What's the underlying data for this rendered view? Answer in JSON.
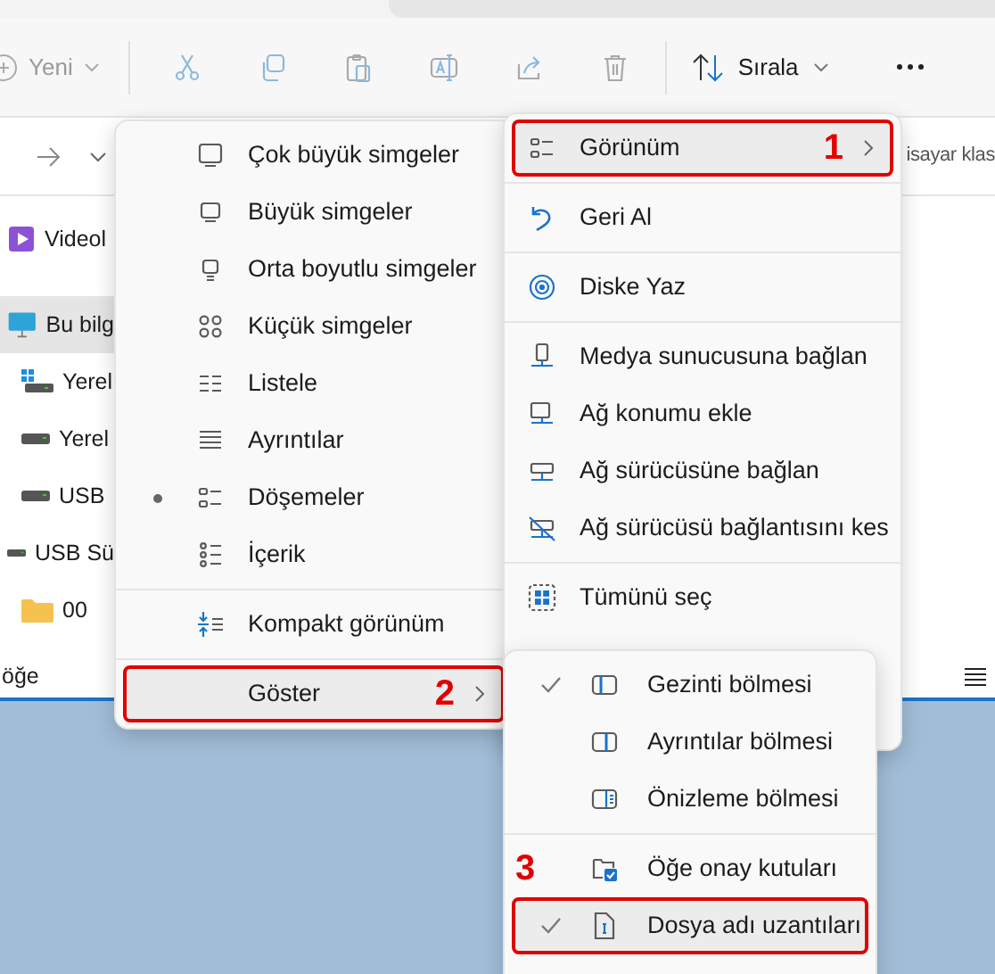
{
  "toolbar": {
    "new_label": "Yeni",
    "sort_label": "Sırala",
    "actions": [
      {
        "kind": "cut"
      },
      {
        "kind": "copy"
      },
      {
        "kind": "paste"
      },
      {
        "kind": "rename"
      },
      {
        "kind": "share"
      },
      {
        "kind": "delete"
      }
    ]
  },
  "address_bar": {
    "search_text": "isayar klas"
  },
  "sidebar": {
    "items": [
      {
        "label": "Videol",
        "kind": "videos",
        "selected": false
      },
      {
        "label": "Bu bilg",
        "kind": "computer",
        "selected": true,
        "children": [
          {
            "label": "Yerel",
            "kind": "system-drive",
            "selected": false
          },
          {
            "label": "Yerel",
            "kind": "drive",
            "selected": false
          },
          {
            "label": "USB",
            "kind": "drive",
            "selected": false
          }
        ]
      },
      {
        "label": "USB Sü",
        "kind": "drive",
        "selected": false,
        "children": [
          {
            "label": "00",
            "kind": "folder",
            "selected": false
          }
        ]
      }
    ]
  },
  "status_bar": {
    "text": "öğe"
  },
  "view_menu": {
    "groups": [
      [
        {
          "label": "Çok büyük simgeler",
          "kind": "xl",
          "selected": false
        },
        {
          "label": "Büyük simgeler",
          "kind": "large",
          "selected": false
        },
        {
          "label": "Orta boyutlu simgeler",
          "kind": "medium",
          "selected": false
        },
        {
          "label": "Küçük simgeler",
          "kind": "small",
          "selected": false
        },
        {
          "label": "Listele",
          "kind": "list",
          "selected": false
        },
        {
          "label": "Ayrıntılar",
          "kind": "details",
          "selected": false
        },
        {
          "label": "Döşemeler",
          "kind": "tiles",
          "selected": true
        },
        {
          "label": "İçerik",
          "kind": "content",
          "selected": false
        }
      ],
      [
        {
          "label": "Kompakt görünüm",
          "kind": "compact",
          "selected": false
        }
      ],
      [
        {
          "label": "Göster",
          "kind": "show",
          "highlighted": true,
          "annotation": "2"
        }
      ]
    ]
  },
  "context_menu": {
    "groups": [
      [
        {
          "label": "Görünüm",
          "kind": "tiles",
          "highlighted": true,
          "annotation": "1"
        }
      ],
      [
        {
          "label": "Geri Al",
          "kind": "undo"
        }
      ],
      [
        {
          "label": "Diske Yaz",
          "kind": "disc"
        }
      ],
      [
        {
          "label": "Medya sunucusuna bağlan",
          "kind": "media-server"
        },
        {
          "label": "Ağ konumu ekle",
          "kind": "net-location"
        },
        {
          "label": "Ağ sürücüsüne bağlan",
          "kind": "net-drive"
        },
        {
          "label": "Ağ sürücüsü bağlantısını kes",
          "kind": "net-disconnect"
        }
      ],
      [
        {
          "label": "Tümünü seç",
          "kind": "select-all"
        }
      ]
    ]
  },
  "show_menu": {
    "groups": [
      [
        {
          "label": "Gezinti bölmesi",
          "kind": "nav-pane",
          "checked": true
        },
        {
          "label": "Ayrıntılar bölmesi",
          "kind": "details-pane",
          "checked": false
        },
        {
          "label": "Önizleme bölmesi",
          "kind": "preview-pane",
          "checked": false
        }
      ],
      [
        {
          "label": "Öğe onay kutuları",
          "kind": "checkboxes",
          "checked": false
        },
        {
          "label": "Dosya adı uzantıları",
          "kind": "file-ext",
          "checked": true,
          "highlighted": true,
          "annotation": "3"
        }
      ]
    ]
  }
}
